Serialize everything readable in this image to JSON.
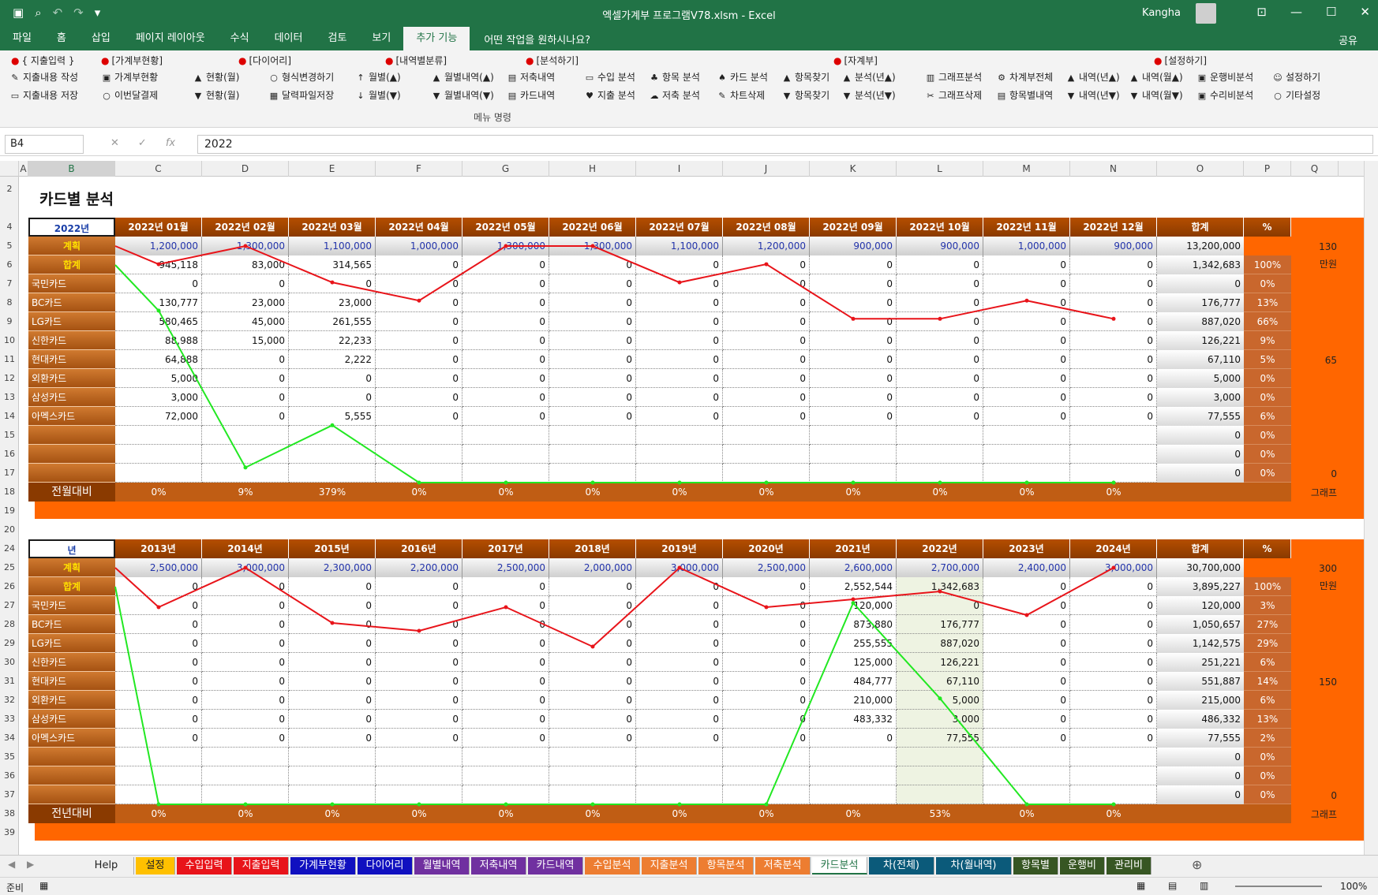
{
  "window": {
    "title": "엑셀가계부 프로그램V78.xlsm  -  Excel",
    "user": "Kangha"
  },
  "menu_tabs": [
    "파일",
    "홈",
    "삽입",
    "페이지 레이아웃",
    "수식",
    "데이터",
    "검토",
    "보기",
    "추가 기능"
  ],
  "active_tab": "추가 기능",
  "tell_me": "어떤 작업을 원하시나요?",
  "share": "공유",
  "ribbon": {
    "groups": [
      "{ 지출입력 }",
      "[가계부현황]",
      "[다이어리]",
      "[내역별분류]",
      "[분석하기]",
      "[자계부]",
      "[설정하기]"
    ],
    "row1": [
      "지출내용 작성",
      "가계부현황",
      "현황(월)",
      "형식변경하기",
      "월별(▲)",
      "월별내역(▲)",
      "저축내역",
      "수입 분석",
      "항목 분석",
      "카드 분석",
      "항목찾기",
      "분석(년▲)",
      "그래프분석",
      "차계부전체",
      "내역(년▲)",
      "내역(월▲)",
      "운행비분석",
      "설정하기"
    ],
    "row2": [
      "지출내용 저장",
      "이번달결제",
      "현황(월)",
      "달력파일저장",
      "월별(▼)",
      "월별내역(▼)",
      "카드내역",
      "지출 분석",
      "저축 분석",
      "차트삭제",
      "항목찾기",
      "분석(년▼)",
      "그래프삭제",
      "항목별내역",
      "내역(년▼)",
      "내역(월▼)",
      "수리비분석",
      "기타설정"
    ],
    "footer": "메뉴 명령"
  },
  "formula": {
    "cell": "B4",
    "value": "2022",
    "fx": "fx"
  },
  "columns": [
    "A",
    "B",
    "C",
    "D",
    "E",
    "F",
    "G",
    "H",
    "I",
    "J",
    "K",
    "L",
    "M",
    "N",
    "O",
    "P",
    "Q"
  ],
  "rows": [
    "2",
    "4",
    "5",
    "6",
    "7",
    "8",
    "9",
    "10",
    "11",
    "12",
    "13",
    "14",
    "15",
    "16",
    "17",
    "18",
    "19",
    "20",
    "24",
    "25",
    "26",
    "27",
    "28",
    "29",
    "30",
    "31",
    "32",
    "33",
    "34",
    "35",
    "36",
    "37",
    "38",
    "39"
  ],
  "sheet_title": "카드별 분석",
  "table1": {
    "year": "2022년",
    "headers": [
      "2022년 01월",
      "2022년 02월",
      "2022년 03월",
      "2022년 04월",
      "2022년 05월",
      "2022년 06월",
      "2022년 07월",
      "2022년 08월",
      "2022년 09월",
      "2022년 10월",
      "2022년 11월",
      "2022년 12월",
      "합계",
      "%"
    ],
    "plan_label": "계획",
    "plan": [
      "1,200,000",
      "1,300,000",
      "1,100,000",
      "1,000,000",
      "1,300,000",
      "1,300,000",
      "1,100,000",
      "1,200,000",
      "900,000",
      "900,000",
      "1,000,000",
      "900,000",
      "13,200,000"
    ],
    "sum_label": "합계",
    "sum": [
      "945,118",
      "83,000",
      "314,565",
      "0",
      "0",
      "0",
      "0",
      "0",
      "0",
      "0",
      "0",
      "0",
      "1,342,683",
      "100%"
    ],
    "cards": [
      {
        "name": "국민카드",
        "v": [
          "0",
          "0",
          "0",
          "0",
          "0",
          "0",
          "0",
          "0",
          "0",
          "0",
          "0",
          "0"
        ],
        "total": "0",
        "pct": "0%"
      },
      {
        "name": "BC카드",
        "v": [
          "130,777",
          "23,000",
          "23,000",
          "0",
          "0",
          "0",
          "0",
          "0",
          "0",
          "0",
          "0",
          "0"
        ],
        "total": "176,777",
        "pct": "13%"
      },
      {
        "name": "LG카드",
        "v": [
          "580,465",
          "45,000",
          "261,555",
          "0",
          "0",
          "0",
          "0",
          "0",
          "0",
          "0",
          "0",
          "0"
        ],
        "total": "887,020",
        "pct": "66%"
      },
      {
        "name": "신한카드",
        "v": [
          "88,988",
          "15,000",
          "22,233",
          "0",
          "0",
          "0",
          "0",
          "0",
          "0",
          "0",
          "0",
          "0"
        ],
        "total": "126,221",
        "pct": "9%"
      },
      {
        "name": "현대카드",
        "v": [
          "64,888",
          "0",
          "2,222",
          "0",
          "0",
          "0",
          "0",
          "0",
          "0",
          "0",
          "0",
          "0"
        ],
        "total": "67,110",
        "pct": "5%"
      },
      {
        "name": "외환카드",
        "v": [
          "5,000",
          "0",
          "0",
          "0",
          "0",
          "0",
          "0",
          "0",
          "0",
          "0",
          "0",
          "0"
        ],
        "total": "5,000",
        "pct": "0%"
      },
      {
        "name": "삼성카드",
        "v": [
          "3,000",
          "0",
          "0",
          "0",
          "0",
          "0",
          "0",
          "0",
          "0",
          "0",
          "0",
          "0"
        ],
        "total": "3,000",
        "pct": "0%"
      },
      {
        "name": "아멕스카드",
        "v": [
          "72,000",
          "0",
          "5,555",
          "0",
          "0",
          "0",
          "0",
          "0",
          "0",
          "0",
          "0",
          "0"
        ],
        "total": "77,555",
        "pct": "6%"
      },
      {
        "name": "",
        "v": [
          "",
          "",
          "",
          "",
          "",
          "",
          "",
          "",
          "",
          "",
          "",
          ""
        ],
        "total": "0",
        "pct": "0%"
      },
      {
        "name": "",
        "v": [
          "",
          "",
          "",
          "",
          "",
          "",
          "",
          "",
          "",
          "",
          "",
          ""
        ],
        "total": "0",
        "pct": "0%"
      },
      {
        "name": "",
        "v": [
          "",
          "",
          "",
          "",
          "",
          "",
          "",
          "",
          "",
          "",
          "",
          ""
        ],
        "total": "0",
        "pct": "0%"
      }
    ],
    "cmp_label": "전월대비",
    "cmp": [
      "0%",
      "9%",
      "379%",
      "0%",
      "0%",
      "0%",
      "0%",
      "0%",
      "0%",
      "0%",
      "0%",
      "0%"
    ],
    "axis": {
      "top": "130",
      "unit": "만원",
      "mid": "65",
      "bottom": "0",
      "graph": "그래프"
    }
  },
  "table2": {
    "year": "년",
    "headers": [
      "2013년",
      "2014년",
      "2015년",
      "2016년",
      "2017년",
      "2018년",
      "2019년",
      "2020년",
      "2021년",
      "2022년",
      "2023년",
      "2024년",
      "합계",
      "%"
    ],
    "plan_label": "계획",
    "plan": [
      "2,500,000",
      "3,000,000",
      "2,300,000",
      "2,200,000",
      "2,500,000",
      "2,000,000",
      "3,000,000",
      "2,500,000",
      "2,600,000",
      "2,700,000",
      "2,400,000",
      "3,000,000",
      "30,700,000"
    ],
    "sum_label": "합계",
    "sum": [
      "0",
      "0",
      "0",
      "0",
      "0",
      "0",
      "0",
      "0",
      "2,552,544",
      "1,342,683",
      "0",
      "0",
      "3,895,227",
      "100%"
    ],
    "cards": [
      {
        "name": "국민카드",
        "v": [
          "0",
          "0",
          "0",
          "0",
          "0",
          "0",
          "0",
          "0",
          "120,000",
          "0",
          "0",
          "0"
        ],
        "total": "120,000",
        "pct": "3%"
      },
      {
        "name": "BC카드",
        "v": [
          "0",
          "0",
          "0",
          "0",
          "0",
          "0",
          "0",
          "0",
          "873,880",
          "176,777",
          "0",
          "0"
        ],
        "total": "1,050,657",
        "pct": "27%"
      },
      {
        "name": "LG카드",
        "v": [
          "0",
          "0",
          "0",
          "0",
          "0",
          "0",
          "0",
          "0",
          "255,555",
          "887,020",
          "0",
          "0"
        ],
        "total": "1,142,575",
        "pct": "29%"
      },
      {
        "name": "신한카드",
        "v": [
          "0",
          "0",
          "0",
          "0",
          "0",
          "0",
          "0",
          "0",
          "125,000",
          "126,221",
          "0",
          "0"
        ],
        "total": "251,221",
        "pct": "6%"
      },
      {
        "name": "현대카드",
        "v": [
          "0",
          "0",
          "0",
          "0",
          "0",
          "0",
          "0",
          "0",
          "484,777",
          "67,110",
          "0",
          "0"
        ],
        "total": "551,887",
        "pct": "14%"
      },
      {
        "name": "외환카드",
        "v": [
          "0",
          "0",
          "0",
          "0",
          "0",
          "0",
          "0",
          "0",
          "210,000",
          "5,000",
          "0",
          "0"
        ],
        "total": "215,000",
        "pct": "6%"
      },
      {
        "name": "삼성카드",
        "v": [
          "0",
          "0",
          "0",
          "0",
          "0",
          "0",
          "0",
          "0",
          "483,332",
          "3,000",
          "0",
          "0"
        ],
        "total": "486,332",
        "pct": "13%"
      },
      {
        "name": "아멕스카드",
        "v": [
          "0",
          "0",
          "0",
          "0",
          "0",
          "0",
          "0",
          "0",
          "0",
          "77,555",
          "0",
          "0"
        ],
        "total": "77,555",
        "pct": "2%"
      },
      {
        "name": "",
        "v": [
          "",
          "",
          "",
          "",
          "",
          "",
          "",
          "",
          "",
          "",
          "",
          ""
        ],
        "total": "0",
        "pct": "0%"
      },
      {
        "name": "",
        "v": [
          "",
          "",
          "",
          "",
          "",
          "",
          "",
          "",
          "",
          "",
          "",
          ""
        ],
        "total": "0",
        "pct": "0%"
      },
      {
        "name": "",
        "v": [
          "",
          "",
          "",
          "",
          "",
          "",
          "",
          "",
          "",
          "",
          "",
          ""
        ],
        "total": "0",
        "pct": "0%"
      }
    ],
    "cmp_label": "전년대비",
    "cmp": [
      "0%",
      "0%",
      "0%",
      "0%",
      "0%",
      "0%",
      "0%",
      "0%",
      "0%",
      "53%",
      "0%",
      "0%"
    ],
    "axis": {
      "top": "300",
      "unit": "만원",
      "mid": "150",
      "bottom": "0",
      "graph": "그래프"
    }
  },
  "chart_data": [
    {
      "type": "line",
      "x": [
        "2022년 01월",
        "2022년 02월",
        "2022년 03월",
        "2022년 04월",
        "2022년 05월",
        "2022년 06월",
        "2022년 07월",
        "2022년 08월",
        "2022년 09월",
        "2022년 10월",
        "2022년 11월",
        "2022년 12월"
      ],
      "ylim": [
        0,
        130
      ],
      "series": [
        {
          "name": "계획",
          "values": [
            120,
            130,
            110,
            100,
            130,
            130,
            110,
            120,
            90,
            90,
            100,
            90
          ],
          "color": "#e8141a"
        },
        {
          "name": "합계",
          "values": [
            94.5,
            8.3,
            31.5,
            0,
            0,
            0,
            0,
            0,
            0,
            0,
            0,
            0
          ],
          "color": "#22e822"
        }
      ]
    },
    {
      "type": "line",
      "x": [
        "2013년",
        "2014년",
        "2015년",
        "2016년",
        "2017년",
        "2018년",
        "2019년",
        "2020년",
        "2021년",
        "2022년",
        "2023년",
        "2024년"
      ],
      "ylim": [
        0,
        300
      ],
      "series": [
        {
          "name": "계획",
          "values": [
            250,
            300,
            230,
            220,
            250,
            200,
            300,
            250,
            260,
            270,
            240,
            300
          ],
          "color": "#e8141a"
        },
        {
          "name": "합계",
          "values": [
            0,
            0,
            0,
            0,
            0,
            0,
            0,
            0,
            255.3,
            134.3,
            0,
            0
          ],
          "color": "#22e822"
        }
      ]
    }
  ],
  "sheet_tabs": [
    {
      "name": "Help",
      "bg": "#f0f0f0",
      "fg": "#222"
    },
    {
      "name": "설정",
      "bg": "#ffc000",
      "fg": "#222"
    },
    {
      "name": "수입입력",
      "bg": "#e8141a",
      "fg": "#fff"
    },
    {
      "name": "지출입력",
      "bg": "#e8141a",
      "fg": "#fff"
    },
    {
      "name": "가계부현황",
      "bg": "#1010c0",
      "fg": "#fff"
    },
    {
      "name": "다이어리",
      "bg": "#1010c0",
      "fg": "#fff"
    },
    {
      "name": "월별내역",
      "bg": "#7030a0",
      "fg": "#fff"
    },
    {
      "name": "저축내역",
      "bg": "#7030a0",
      "fg": "#fff"
    },
    {
      "name": "카드내역",
      "bg": "#7030a0",
      "fg": "#fff"
    },
    {
      "name": "수입분석",
      "bg": "#ed7d31",
      "fg": "#fff"
    },
    {
      "name": "지출분석",
      "bg": "#ed7d31",
      "fg": "#fff"
    },
    {
      "name": "항목분석",
      "bg": "#ed7d31",
      "fg": "#fff"
    },
    {
      "name": "저축분석",
      "bg": "#ed7d31",
      "fg": "#fff"
    },
    {
      "name": "카드분석",
      "bg": "#ffffff",
      "fg": "#217346"
    },
    {
      "name": "차(전체)",
      "bg": "#0b5a7a",
      "fg": "#fff"
    },
    {
      "name": "차(월내역)",
      "bg": "#0b5a7a",
      "fg": "#fff"
    },
    {
      "name": "항목별",
      "bg": "#375623",
      "fg": "#fff"
    },
    {
      "name": "운행비",
      "bg": "#375623",
      "fg": "#fff"
    },
    {
      "name": "관리비",
      "bg": "#375623",
      "fg": "#fff"
    }
  ],
  "status": {
    "ready": "준비",
    "zoom": "100%"
  }
}
